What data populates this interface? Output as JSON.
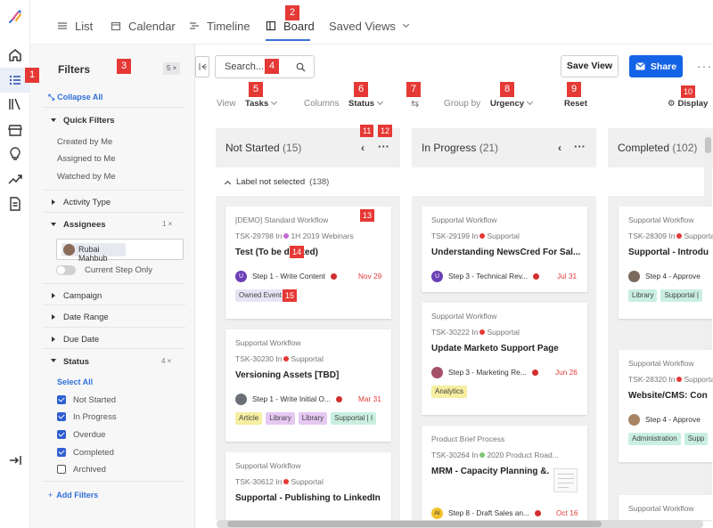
{
  "nav": {
    "tabs": [
      {
        "label": "List"
      },
      {
        "label": "Calendar"
      },
      {
        "label": "Timeline"
      },
      {
        "label": "Board"
      },
      {
        "label": "Saved Views"
      }
    ]
  },
  "filters": {
    "title": "Filters",
    "count": "5 ×",
    "collapse_all": "Collapse All",
    "quick_filters": "Quick Filters",
    "quick_items": [
      "Created by Me",
      "Assigned to Me",
      "Watched by Me"
    ],
    "activity_type": "Activity Type",
    "assignees": "Assignees",
    "assignees_count": "1 ×",
    "assignee_chip": "Rubai Mahbub",
    "current_step_only": "Current Step Only",
    "campaign": "Campaign",
    "date_range": "Date Range",
    "due_date": "Due Date",
    "status": "Status",
    "status_count": "4 ×",
    "select_all": "Select All",
    "status_options": [
      {
        "label": "Not Started",
        "checked": true
      },
      {
        "label": "In Progress",
        "checked": true
      },
      {
        "label": "Overdue",
        "checked": true
      },
      {
        "label": "Completed",
        "checked": true
      },
      {
        "label": "Archived",
        "checked": false
      }
    ],
    "add_filters": "Add Filters"
  },
  "toolbar": {
    "search_placeholder": "Search...",
    "save_view": "Save View",
    "share": "Share",
    "view_label": "View",
    "view_value": "Tasks",
    "columns_label": "Columns",
    "columns_value": "Status",
    "group_by_label": "Group by",
    "group_by_value": "Urgency",
    "reset": "Reset",
    "display": "Display"
  },
  "board": {
    "group_label": "Label not selected",
    "group_count": "(138)",
    "columns": [
      {
        "title": "Not Started",
        "count": "(15)",
        "cards": [
          {
            "workflow": "[DEMO] Standard Workflow",
            "id": "TSK-29798 In",
            "project": "1H 2019 Webinars",
            "project_color": "#c46bd6",
            "title": "Test (To be deleted)",
            "step": "Step 1 - Write Content",
            "date": "Nov 29",
            "avatar": "U",
            "tags": [
              {
                "text": "Owned Event",
                "bg": "#e9e4f3"
              }
            ]
          },
          {
            "workflow": "Supportal Workflow",
            "id": "TSK-30230 In",
            "project": "Supportal",
            "project_color": "#e53935",
            "title": "Versioning Assets [TBD]",
            "step": "Step 1 - Write Initial O...",
            "date": "Mar 31",
            "avatar": "photo",
            "tags": [
              {
                "text": "Article",
                "bg": "#f6eea0"
              },
              {
                "text": "Library",
                "bg": "#e6c8f2"
              },
              {
                "text": "Library",
                "bg": "#e6c8f2"
              },
              {
                "text": "Supportal | I",
                "bg": "#c9efe0"
              }
            ]
          },
          {
            "workflow": "Supportal Workflow",
            "id": "TSK-30612 In",
            "project": "Supportal",
            "project_color": "#e53935",
            "title": "Supportal - Publishing to LinkedIn"
          }
        ]
      },
      {
        "title": "In Progress",
        "count": "(21)",
        "cards": [
          {
            "workflow": "Supportal Workflow",
            "id": "TSK-29199 In",
            "project": "Supportal",
            "project_color": "#e53935",
            "title": "Understanding NewsCred For Sal...",
            "step": "Step 3 - Technical Rev...",
            "date": "Jul 31",
            "avatar": "U",
            "tags": []
          },
          {
            "workflow": "Supportal Workflow",
            "id": "TSK-30222 In",
            "project": "Supportal",
            "project_color": "#e53935",
            "title": "Update Marketo Support Page",
            "step": "Step 3 - Marketing Re...",
            "date": "Jun 26",
            "avatar": "photo2",
            "tags": [
              {
                "text": "Analytics",
                "bg": "#f6eea0"
              }
            ]
          },
          {
            "workflow": "Product Brief Process",
            "id": "TSK-30264 In",
            "project": "2020 Product Road...",
            "project_color": "#7cc576",
            "title": "MRM - Capacity Planning &...",
            "step": "Step 8 - Draft Sales an...",
            "date": "Oct 16",
            "avatar": "AI",
            "tags": []
          }
        ]
      },
      {
        "title": "Completed",
        "count": "(102)",
        "cards": [
          {
            "workflow": "Supportal Workflow",
            "id": "TSK-28309 In",
            "project": "Supportal",
            "project_color": "#e53935",
            "title": "Supportal - Introdu",
            "step": "Step 4 - Approve",
            "avatar": "photo3",
            "tags": [
              {
                "text": "Library",
                "bg": "#c9efe0"
              },
              {
                "text": "Supportal |",
                "bg": "#c9efe0"
              }
            ]
          },
          {
            "workflow": "Supportal Workflow",
            "id": "TSK-28320 In",
            "project": "Supportal",
            "project_color": "#e53935",
            "title": "Website/CMS: Con",
            "step": "Step 4 - Approve",
            "avatar": "photo4",
            "tags": [
              {
                "text": "Administration",
                "bg": "#c9efe0"
              },
              {
                "text": "Supp",
                "bg": "#c9efe0"
              }
            ]
          },
          {
            "workflow": "Supportal Workflow"
          }
        ]
      }
    ]
  },
  "markers": [
    "1",
    "2",
    "3",
    "4",
    "5",
    "6",
    "7",
    "8",
    "9",
    "10",
    "11",
    "12",
    "13",
    "14",
    "15"
  ]
}
